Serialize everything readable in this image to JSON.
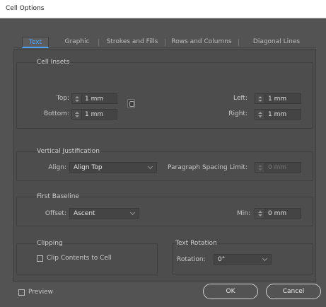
{
  "window": {
    "title": "Cell Options"
  },
  "tabs": [
    {
      "label": "Text",
      "active": true
    },
    {
      "label": "Graphic",
      "active": false
    },
    {
      "label": "Strokes and Fills",
      "active": false
    },
    {
      "label": "Rows and Columns",
      "active": false
    },
    {
      "label": "Diagonal Lines",
      "active": false
    }
  ],
  "cell_insets": {
    "title": "Cell Insets",
    "top_label": "Top:",
    "top_value": "1 mm",
    "bottom_label": "Bottom:",
    "bottom_value": "1 mm",
    "left_label": "Left:",
    "left_value": "1 mm",
    "right_label": "Right:",
    "right_value": "1 mm"
  },
  "vertical_justification": {
    "title": "Vertical Justification",
    "align_label": "Align:",
    "align_value": "Align Top",
    "spacing_label": "Paragraph Spacing Limit:",
    "spacing_value": "0 mm"
  },
  "first_baseline": {
    "title": "First Baseline",
    "offset_label": "Offset:",
    "offset_value": "Ascent",
    "min_label": "Min:",
    "min_value": "0 mm"
  },
  "clipping": {
    "title": "Clipping",
    "clip_label": "Clip Contents to Cell"
  },
  "text_rotation": {
    "title": "Text Rotation",
    "rotation_label": "Rotation:",
    "rotation_value": "0°"
  },
  "footer": {
    "preview_label": "Preview",
    "ok_label": "OK",
    "cancel_label": "Cancel"
  },
  "colors": {
    "dialog_bg": "#535353",
    "accent": "#4aa3ff"
  }
}
